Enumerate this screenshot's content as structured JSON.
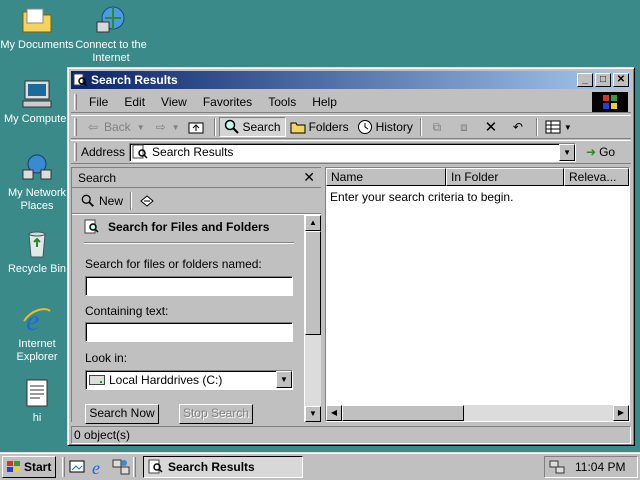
{
  "desktop": {
    "icons": [
      {
        "label": "My Documents"
      },
      {
        "label": "Connect to the Internet"
      },
      {
        "label": "My Computer"
      },
      {
        "label": "My Network Places"
      },
      {
        "label": "Recycle Bin"
      },
      {
        "label": "Internet Explorer"
      },
      {
        "label": "hi"
      }
    ]
  },
  "window": {
    "title": "Search Results",
    "title_buttons": {
      "minimize": "_",
      "maximize": "□",
      "close": "✕"
    },
    "menu": [
      "File",
      "Edit",
      "View",
      "Favorites",
      "Tools",
      "Help"
    ],
    "toolbar": {
      "back": "Back",
      "search": "Search",
      "folders": "Folders",
      "history": "History"
    },
    "address": {
      "label": "Address",
      "value": "Search Results",
      "go": "Go"
    },
    "search_pane": {
      "title": "Search",
      "new_label": "New",
      "heading": "Search for Files and Folders",
      "named_label": "Search for files or folders named:",
      "named_value": "",
      "containing_label": "Containing text:",
      "containing_value": "",
      "lookin_label": "Look in:",
      "lookin_value": "Local Harddrives (C:)",
      "search_now": "Search Now",
      "stop_search": "Stop Search"
    },
    "results": {
      "columns": [
        "Name",
        "In Folder",
        "Releva..."
      ],
      "empty_message": "Enter your search criteria to begin."
    },
    "status": "0 object(s)"
  },
  "taskbar": {
    "start": "Start",
    "task": "Search Results",
    "clock": "11:04 PM"
  },
  "colors": {
    "desktop": "#3a8a8a",
    "titlebar_start": "#0a246a",
    "titlebar_end": "#a6caf0",
    "face": "#c0c0c0"
  }
}
